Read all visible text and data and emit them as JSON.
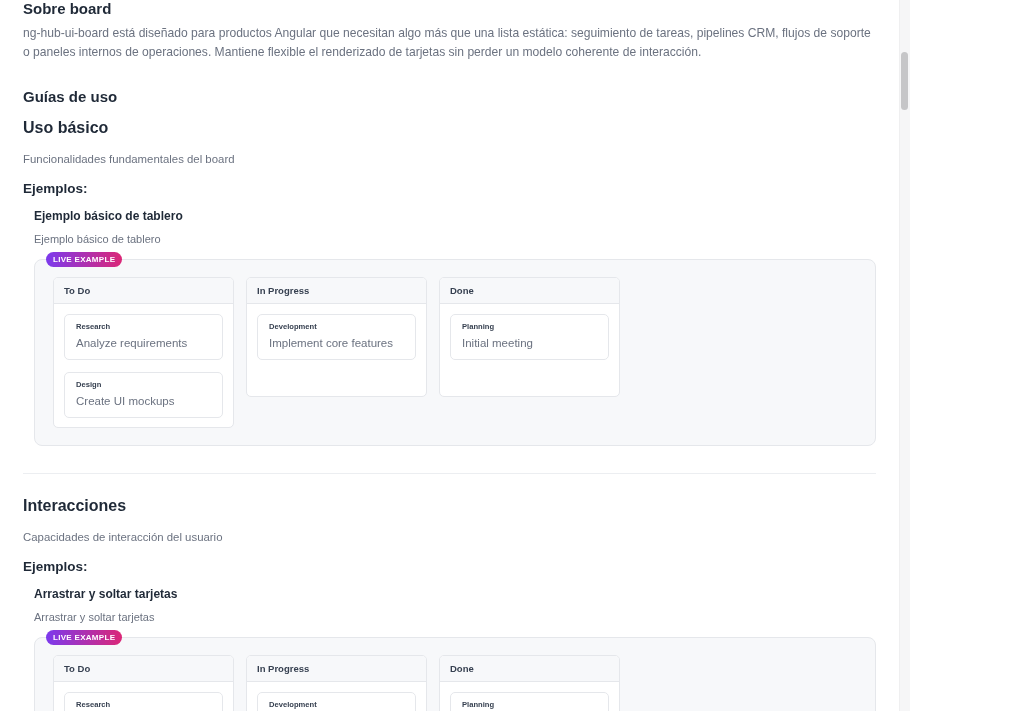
{
  "about": {
    "title": "Sobre board",
    "text": "ng-hub-ui-board está diseñado para productos Angular que necesitan algo más que una lista estática: seguimiento de tareas, pipelines CRM, flujos de soporte o paneles internos de operaciones. Mantiene flexible el renderizado de tarjetas sin perder un modelo coherente de interacción."
  },
  "guides_title": "Guías de uso",
  "sections": [
    {
      "title": "Uso básico",
      "description": "Funcionalidades fundamentales del board",
      "examples_label": "Ejemplos:",
      "examples": [
        {
          "title": "Ejemplo básico de tablero",
          "description": "Ejemplo básico de tablero",
          "badge": "LIVE EXAMPLE",
          "board": {
            "columns": [
              {
                "title": "To Do",
                "cards": [
                  {
                    "tag": "Research",
                    "title": "Analyze requirements"
                  },
                  {
                    "tag": "Design",
                    "title": "Create UI mockups"
                  }
                ]
              },
              {
                "title": "In Progress",
                "cards": [
                  {
                    "tag": "Development",
                    "title": "Implement core features"
                  }
                ]
              },
              {
                "title": "Done",
                "cards": [
                  {
                    "tag": "Planning",
                    "title": "Initial meeting"
                  }
                ]
              }
            ]
          }
        }
      ]
    },
    {
      "title": "Interacciones",
      "description": "Capacidades de interacción del usuario",
      "examples_label": "Ejemplos:",
      "examples": [
        {
          "title": "Arrastrar y soltar tarjetas",
          "description": "Arrastrar y soltar tarjetas",
          "badge": "LIVE EXAMPLE",
          "board": {
            "columns": [
              {
                "title": "To Do",
                "cards": [
                  {
                    "tag": "Research"
                  }
                ]
              },
              {
                "title": "In Progress",
                "cards": [
                  {
                    "tag": "Development"
                  }
                ]
              },
              {
                "title": "Done",
                "cards": [
                  {
                    "tag": "Planning"
                  }
                ]
              }
            ]
          }
        }
      ]
    }
  ]
}
